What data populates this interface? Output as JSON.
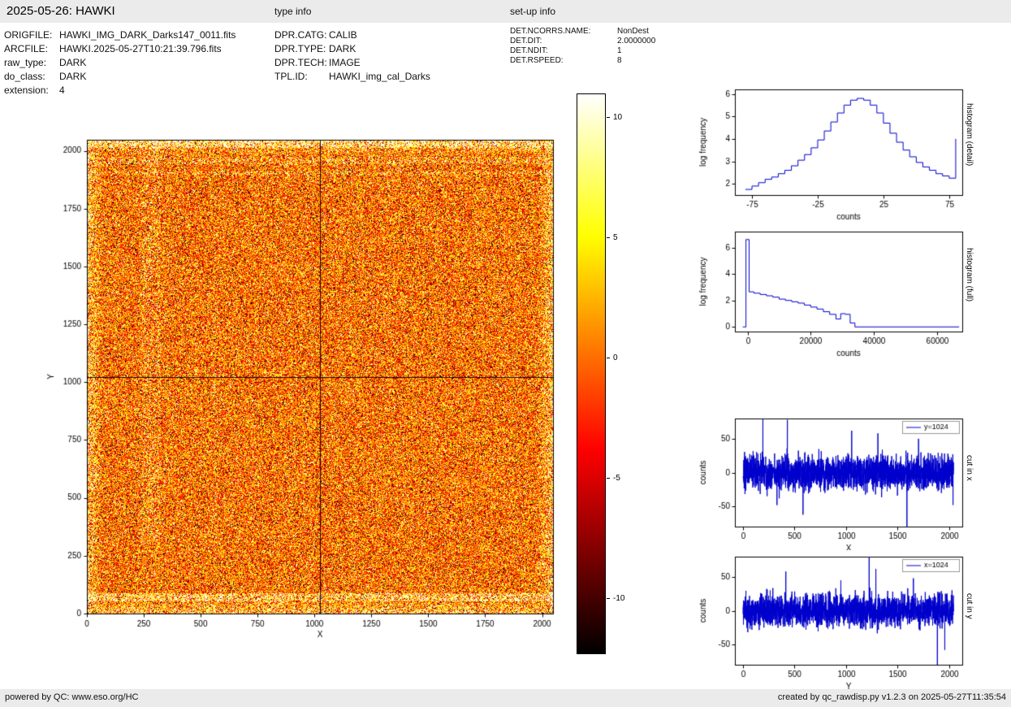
{
  "header": {
    "title": "2025-05-26: HAWKI",
    "type_info_label": "type info",
    "setup_info_label": "set-up info"
  },
  "file_info": {
    "rows": [
      {
        "label": "ORIGFILE:",
        "value": "HAWKI_IMG_DARK_Darks147_0011.fits"
      },
      {
        "label": "ARCFILE:",
        "value": "HAWKI.2025-05-27T10:21:39.796.fits"
      },
      {
        "label": "raw_type:",
        "value": "DARK"
      },
      {
        "label": "do_class:",
        "value": "DARK"
      },
      {
        "label": "extension:",
        "value": "4"
      }
    ]
  },
  "type_info": {
    "rows": [
      {
        "label": "DPR.CATG:",
        "value": "CALIB"
      },
      {
        "label": "DPR.TYPE:",
        "value": "DARK"
      },
      {
        "label": "DPR.TECH:",
        "value": "IMAGE"
      },
      {
        "label": "TPL.ID:",
        "value": "HAWKI_img_cal_Darks"
      }
    ]
  },
  "setup_info": {
    "rows": [
      {
        "label": "DET.NCORRS.NAME:",
        "value": "NonDest"
      },
      {
        "label": "DET.DIT:",
        "value": "2.0000000"
      },
      {
        "label": "DET.NDIT:",
        "value": "1"
      },
      {
        "label": "DET.RSPEED:",
        "value": "8"
      }
    ]
  },
  "image_plot": {
    "xlabel": "X",
    "ylabel": "Y",
    "size": 2048,
    "xticks": [
      0,
      250,
      500,
      750,
      1000,
      1250,
      1500,
      1750,
      2000
    ],
    "yticks": [
      0,
      250,
      500,
      750,
      1000,
      1250,
      1500,
      1750,
      2000
    ],
    "crosshair_x": 1024,
    "crosshair_y": 1024,
    "colormap": "hot",
    "vmin": -12.3,
    "vmax": 11
  },
  "colorbar": {
    "tick_labels": [
      "10",
      "5",
      "0",
      "-5",
      "-10"
    ],
    "tick_values": [
      10,
      5,
      0,
      -5,
      -10
    ],
    "vmax": 11,
    "vmin": -12.3
  },
  "chart_data": [
    {
      "id": "hist_detail",
      "type": "line",
      "step": true,
      "side_label": "histogram (detail)",
      "xlabel": "counts",
      "ylabel": "log frequency",
      "xlim": [
        -88,
        85
      ],
      "ylim": [
        1.5,
        6.2
      ],
      "xticks": [
        -75,
        -25,
        25,
        75
      ],
      "yticks": [
        2,
        3,
        4,
        5,
        6
      ],
      "color": "#0000cc",
      "x": [
        -80,
        -75,
        -70,
        -65,
        -60,
        -55,
        -50,
        -45,
        -40,
        -35,
        -30,
        -25,
        -20,
        -15,
        -10,
        -5,
        0,
        5,
        10,
        15,
        20,
        25,
        30,
        35,
        40,
        45,
        50,
        55,
        60,
        65,
        70,
        75,
        80
      ],
      "y": [
        1.75,
        1.9,
        2.05,
        2.2,
        2.3,
        2.45,
        2.6,
        2.8,
        3.05,
        3.3,
        3.6,
        3.95,
        4.35,
        4.75,
        5.15,
        5.5,
        5.72,
        5.8,
        5.72,
        5.5,
        5.15,
        4.7,
        4.25,
        3.85,
        3.5,
        3.2,
        2.95,
        2.75,
        2.6,
        2.45,
        2.35,
        2.25,
        4.0
      ]
    },
    {
      "id": "hist_full",
      "type": "line",
      "step": true,
      "side_label": "histogram (full)",
      "xlabel": "counts",
      "ylabel": "log frequency",
      "xlim": [
        -4000,
        68000
      ],
      "ylim": [
        -0.35,
        7.2
      ],
      "xticks": [
        0,
        20000,
        40000,
        60000
      ],
      "yticks": [
        0,
        2,
        4,
        6
      ],
      "color": "#0000cc",
      "x": [
        -1500,
        -500,
        500,
        2000,
        4000,
        6000,
        8000,
        10000,
        12000,
        14000,
        16000,
        18000,
        20000,
        22000,
        24000,
        26000,
        28000,
        29500,
        31000,
        32500,
        34000,
        67000
      ],
      "y": [
        0,
        6.6,
        2.65,
        2.55,
        2.45,
        2.35,
        2.25,
        2.1,
        2.0,
        1.9,
        1.8,
        1.65,
        1.5,
        1.35,
        1.15,
        0.95,
        0.6,
        1.0,
        0.95,
        0.3,
        0,
        0
      ]
    },
    {
      "id": "cut_in_x",
      "type": "line",
      "side_label": "cut in x",
      "legend": "y=1024",
      "xlabel": "X",
      "ylabel": "counts",
      "xlim": [
        -80,
        2130
      ],
      "ylim": [
        -80,
        80
      ],
      "xticks": [
        0,
        500,
        1000,
        1500,
        2000
      ],
      "yticks": [
        -50,
        0,
        50
      ],
      "color": "#0000cc",
      "noise": {
        "n": 2048,
        "mean": 0,
        "std": 13,
        "seed": 7
      },
      "spikes": [
        {
          "x": 192,
          "y": 160
        },
        {
          "x": 430,
          "y": 78
        },
        {
          "x": 1055,
          "y": 62
        },
        {
          "x": 1310,
          "y": 58
        },
        {
          "x": 1592,
          "y": -160
        },
        {
          "x": 1705,
          "y": 50
        },
        {
          "x": 2040,
          "y": -48
        }
      ]
    },
    {
      "id": "cut_in_y",
      "type": "line",
      "side_label": "cut in y",
      "legend": "x=1024",
      "xlabel": "Y",
      "ylabel": "counts",
      "xlim": [
        -80,
        2130
      ],
      "ylim": [
        -80,
        80
      ],
      "xticks": [
        0,
        500,
        1000,
        1500,
        2000
      ],
      "yticks": [
        -50,
        0,
        50
      ],
      "color": "#0000cc",
      "noise": {
        "n": 2048,
        "mean": 0,
        "std": 12,
        "seed": 11
      },
      "spikes": [
        {
          "x": 415,
          "y": 58
        },
        {
          "x": 950,
          "y": 45
        },
        {
          "x": 1225,
          "y": 160
        },
        {
          "x": 1290,
          "y": 62
        },
        {
          "x": 1655,
          "y": 48
        },
        {
          "x": 1888,
          "y": -150
        },
        {
          "x": 1960,
          "y": -58
        }
      ]
    }
  ],
  "footer": {
    "left": "powered by QC: www.eso.org/HC",
    "right": "created by qc_rawdisp.py v1.2.3 on 2025-05-27T11:35:54"
  }
}
